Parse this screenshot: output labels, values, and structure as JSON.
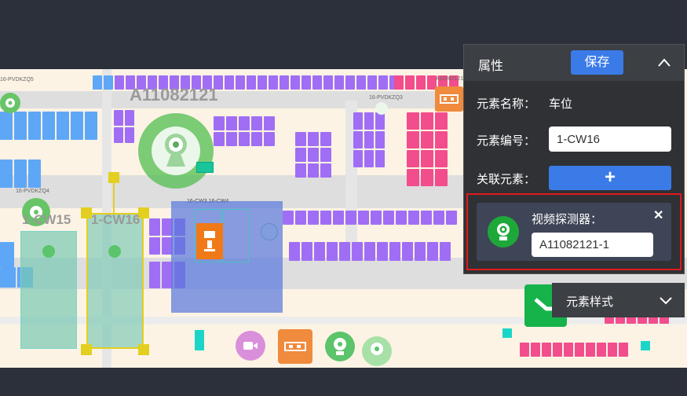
{
  "map": {
    "camera_label": "A11082121",
    "parking_labels": [
      "1-CW15",
      "1-CW16"
    ],
    "tiny_labels": [
      "16-PVDKZQ5",
      "16-PVDKZQ3",
      "16-PVDKZQ4",
      "16-CW3  16-CW4",
      "A11082121"
    ]
  },
  "panel": {
    "title": "属性",
    "save_label": "保存",
    "element_name_label": "元素名称：",
    "element_name_value": "车位",
    "element_code_label": "元素编号：",
    "element_code_value": "1-CW16",
    "related_label": "关联元素：",
    "add_symbol": "+",
    "related_card": {
      "type_label": "视频探测器：",
      "value": "A11082121-1",
      "close_symbol": "✕"
    }
  },
  "style_section": {
    "label": "元素样式"
  },
  "colors": {
    "accent_blue": "#3b7be8",
    "highlight_red": "#e0191b",
    "camera_green": "#1fa83a"
  }
}
